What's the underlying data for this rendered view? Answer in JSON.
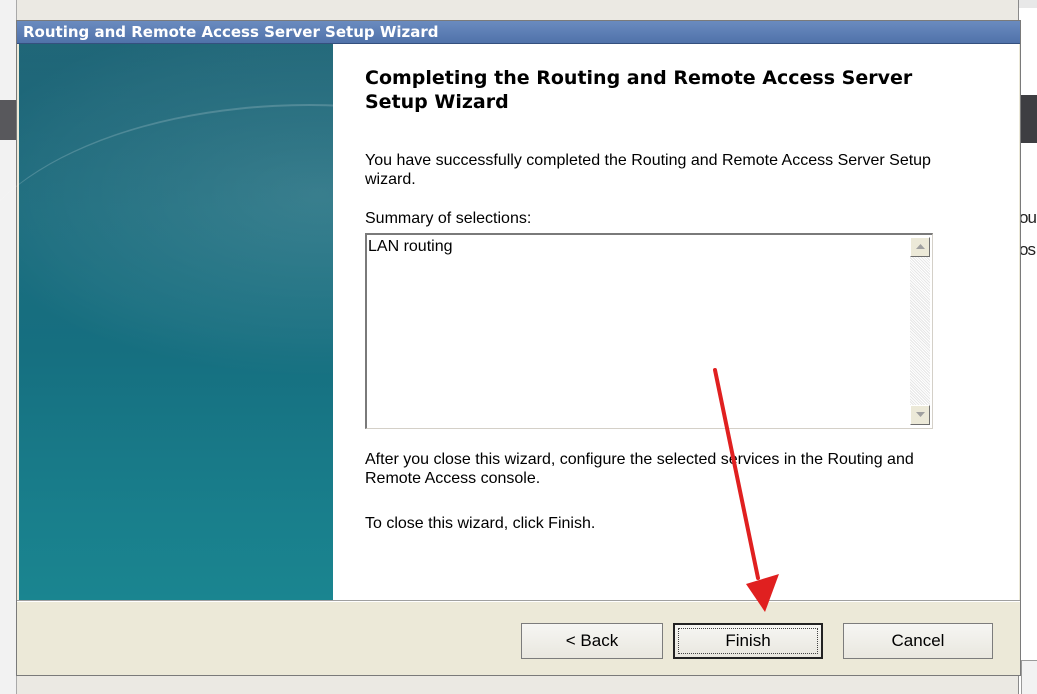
{
  "window": {
    "title": "Routing and Remote Access Server Setup Wizard"
  },
  "page": {
    "heading": "Completing the Routing and Remote Access Server Setup Wizard",
    "success_text": "You have successfully completed the Routing and Remote Access Server Setup wizard.",
    "summary_label": "Summary of selections:",
    "summary_items": [
      "LAN routing"
    ],
    "after_text": "After you close this wizard, configure the selected services in the Routing and  Remote Access console.",
    "close_instruction": "To close this wizard, click Finish."
  },
  "buttons": {
    "back": "< Back",
    "finish": "Finish",
    "cancel": "Cancel"
  },
  "background_fragments": {
    "right_line1": "ou",
    "right_line2": "os"
  },
  "annotation": {
    "arrow_color": "#e02020"
  },
  "colors": {
    "titlebar": "#5072aa",
    "side_panel": "#1a6b7d"
  }
}
